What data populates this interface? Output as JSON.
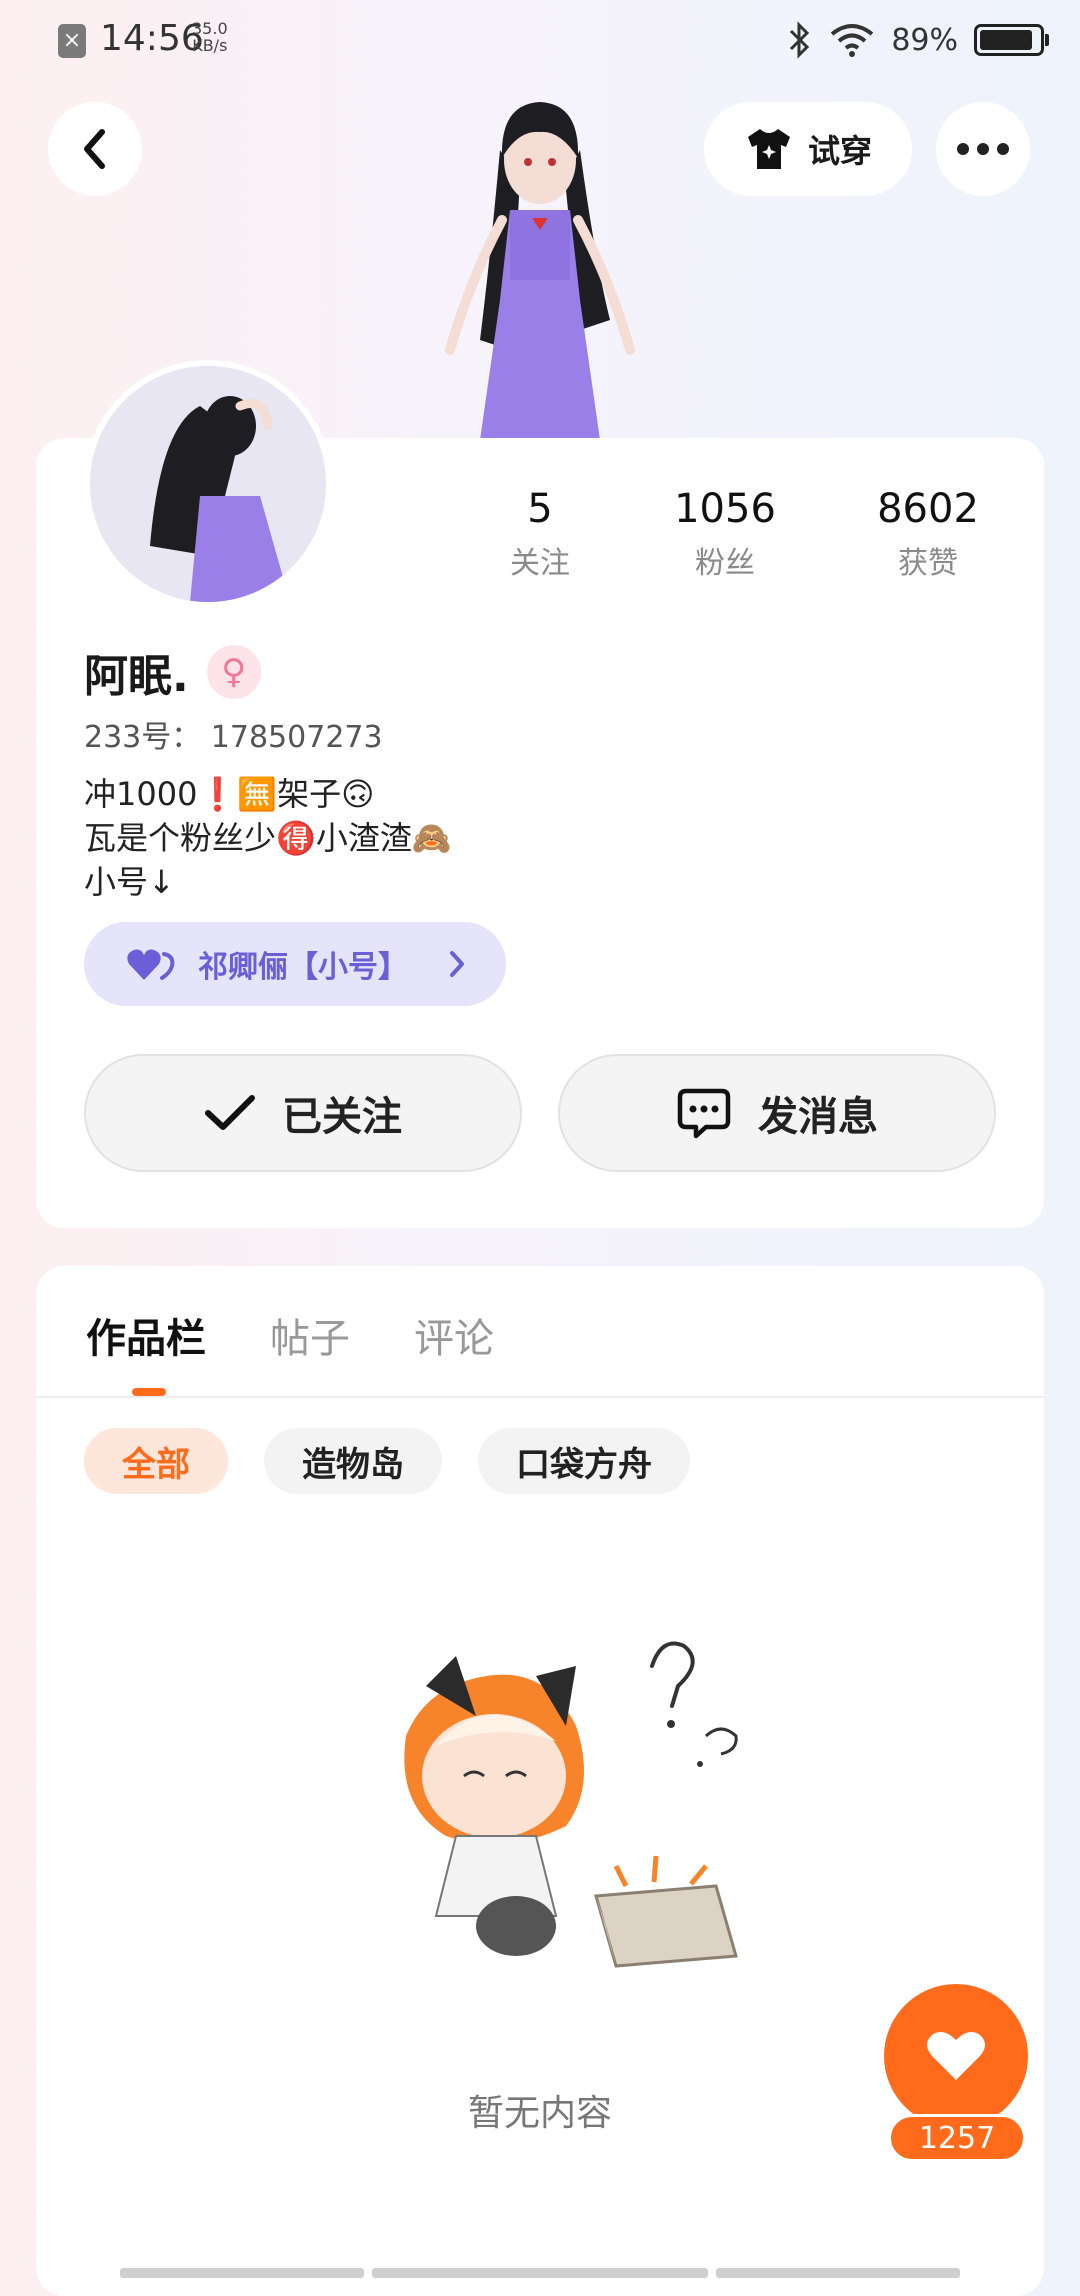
{
  "status_bar": {
    "time": "14:56",
    "net_speed_value": "35.0",
    "net_speed_unit": "KB/s",
    "battery": "89%",
    "icons": [
      "notification-x-icon",
      "bluetooth-icon",
      "wifi-icon",
      "battery-icon"
    ]
  },
  "header": {
    "back_icon": "chevron-left-icon",
    "tryon_label": "试穿",
    "tryon_icon": "tshirt-icon",
    "more_icon": "more-dots-icon"
  },
  "profile": {
    "stats": [
      {
        "value": "5",
        "label": "关注"
      },
      {
        "value": "1056",
        "label": "粉丝"
      },
      {
        "value": "8602",
        "label": "获赞"
      }
    ],
    "name": "阿眠.",
    "gender_symbol": "♀",
    "uid": "233号： 178507273",
    "bio": [
      "冲1000❗️🈚架子🙃",
      "瓦是个粉丝少🉐小渣渣🙈",
      "小号↓"
    ],
    "alt_account": "祁卿俪【小号】",
    "follow_label": "已关注",
    "message_label": "发消息"
  },
  "content": {
    "tabs": [
      "作品栏",
      "帖子",
      "评论"
    ],
    "active_tab": 0,
    "filters": [
      "全部",
      "造物岛",
      "口袋方舟"
    ],
    "active_filter": 0,
    "empty_text": "暂无内容"
  },
  "like_fab": {
    "count": "1257"
  },
  "colors": {
    "accent": "#ff6b1a",
    "alt_pill_bg": "#e6e4fb",
    "alt_pill_text": "#6b5fd8",
    "gender_bg": "#fde4ea"
  }
}
